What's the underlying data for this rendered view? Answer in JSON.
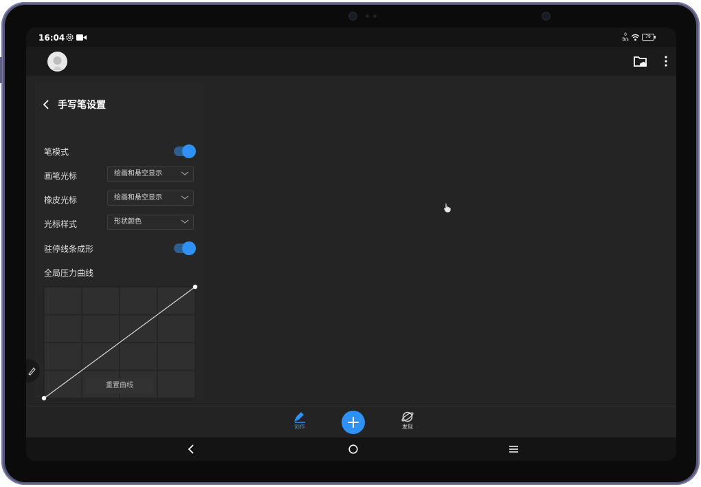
{
  "status": {
    "time": "16:04",
    "speed_top": "0",
    "speed_bottom": "B/s",
    "battery": "79"
  },
  "panel": {
    "title": "手写笔设置",
    "pen_mode_label": "笔模式",
    "brush_cursor_label": "画笔光标",
    "brush_cursor_value": "绘画和悬空显示",
    "eraser_cursor_label": "橡皮光标",
    "eraser_cursor_value": "绘画和悬空显示",
    "cursor_style_label": "光标样式",
    "cursor_style_value": "形状颜色",
    "stroke_shape_label": "驻停线条成形",
    "pressure_curve_label": "全局压力曲线",
    "reset_curve_label": "重置曲线",
    "pen_mode_on": true,
    "stroke_shape_on": true
  },
  "bottom_nav": {
    "create_label": "创作",
    "discover_label": "发现"
  },
  "colors": {
    "accent": "#2f90f6",
    "screen_bg": "#242424",
    "frame": "#55567a"
  },
  "icons": [
    "avatar",
    "settings-icon",
    "video-icon",
    "wifi-icon",
    "battery-icon",
    "folder-cloud-icon",
    "more-icon",
    "back-icon",
    "chevron-down-icon",
    "pen-edit-icon",
    "plus-icon",
    "planet-icon",
    "hand-cursor-icon",
    "nav-back-icon",
    "nav-home-icon",
    "nav-menu-icon"
  ]
}
